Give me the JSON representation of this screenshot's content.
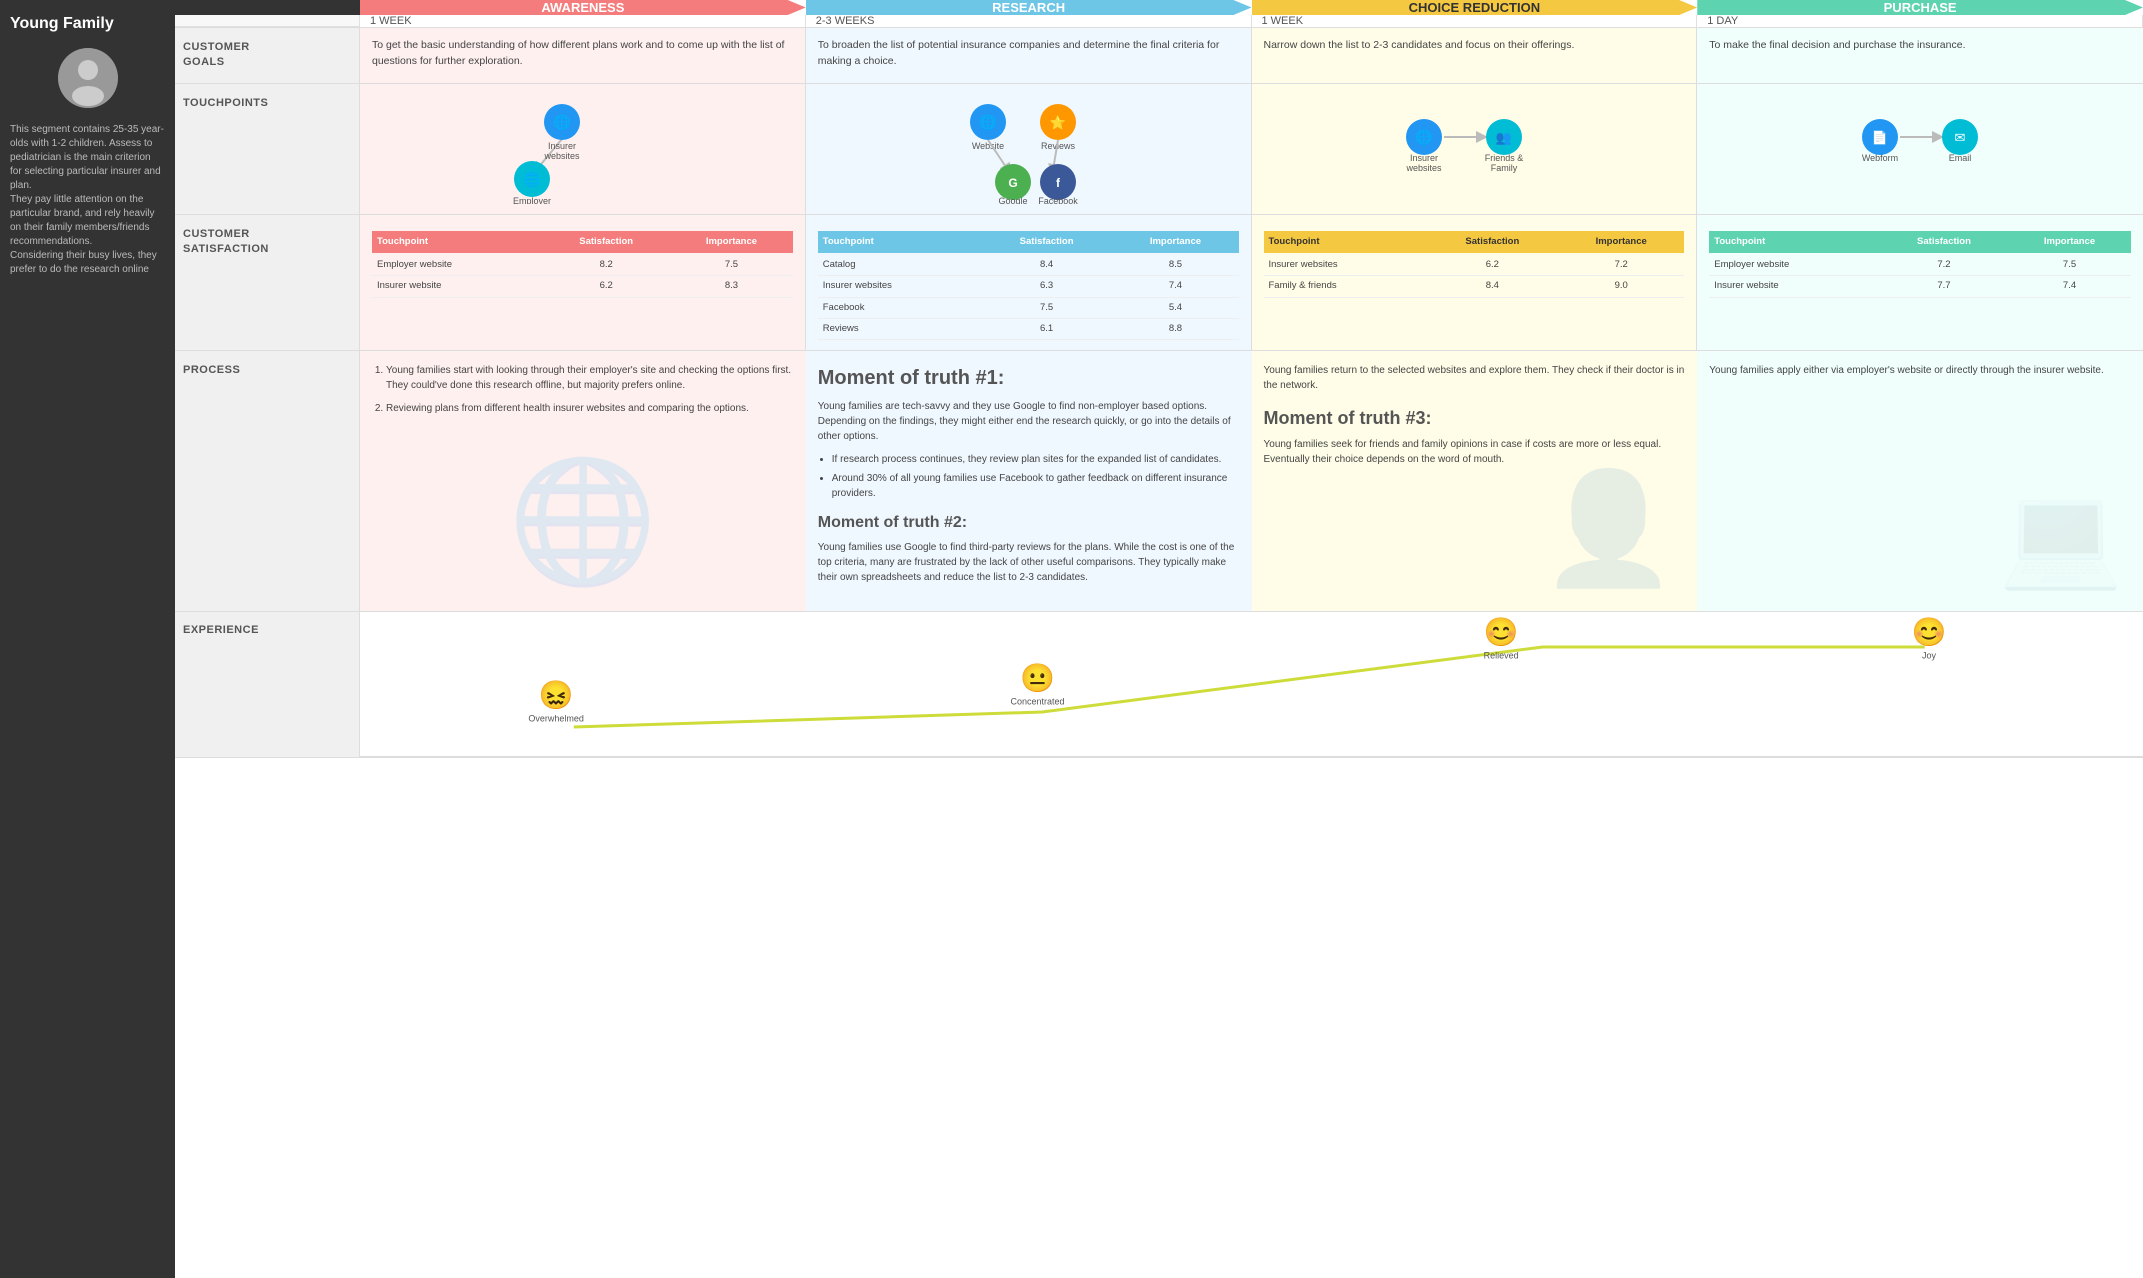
{
  "sidebar": {
    "title": "Young Family",
    "description": "This segment contains 25-35 year-olds with 1-2 children. Assess to pediatrician is the main criterion for selecting particular insurer and plan.\nThey pay little attention on the particular brand, and rely heavily on their family members/friends recommendations.\nConsidering their busy lives, they prefer to do the research online"
  },
  "phases": [
    {
      "id": "awareness",
      "label": "AWARENESS",
      "color": "#f47c7c",
      "time": "1 WEEK",
      "bg": "bg-pink"
    },
    {
      "id": "research",
      "label": "RESEARCH",
      "color": "#6ec6e6",
      "time": "2-3 WEEKS",
      "bg": "bg-blue"
    },
    {
      "id": "choice",
      "label": "CHOICE REDUCTION",
      "color": "#f5c842",
      "time": "1 WEEK",
      "bg": "bg-yellow"
    },
    {
      "id": "purchase",
      "label": "PURCHASE",
      "color": "#5dd3b0",
      "time": "1 DAY",
      "bg": "bg-teal"
    }
  ],
  "rows": {
    "customer_goals": {
      "label": "CUSTOMER GOALS",
      "cells": [
        "To get the basic understanding of how different plans work and to come up with the list of questions for further exploration.",
        "To broaden the list of potential insurance companies and determine the final criteria for making a choice.",
        "Narrow down the list to 2-3 candidates and focus on their offerings.",
        "To make the final decision and purchase the insurance."
      ]
    },
    "touchpoints": {
      "label": "TOUCHPOINTS",
      "awareness": {
        "items": [
          {
            "label": "Insurer websites",
            "icon": "🌐",
            "color": "blue"
          },
          {
            "label": "Employer Website",
            "icon": "🌐",
            "color": "cyan"
          }
        ]
      },
      "research": {
        "items": [
          {
            "label": "Website",
            "icon": "🌐",
            "color": "blue"
          },
          {
            "label": "Reviews",
            "icon": "⭐",
            "color": "orange"
          },
          {
            "label": "Google",
            "icon": "G",
            "color": "green"
          },
          {
            "label": "Facebook",
            "icon": "f",
            "color": "blue"
          }
        ]
      },
      "choice": {
        "items": [
          {
            "label": "Insurer websites",
            "icon": "🌐",
            "color": "blue"
          },
          {
            "label": "Friends & Family",
            "icon": "👥",
            "color": "cyan"
          }
        ]
      },
      "purchase": {
        "items": [
          {
            "label": "Webform",
            "icon": "📄",
            "color": "blue"
          },
          {
            "label": "Email",
            "icon": "✉",
            "color": "cyan"
          }
        ]
      }
    },
    "satisfaction": {
      "label": "CUSTOMER SATISFACTION",
      "tables": [
        {
          "phase_color": "#f47c7c",
          "headers": [
            "Touchpoint",
            "Satisfaction",
            "Importance"
          ],
          "rows": [
            [
              "Employer website",
              "8.2",
              "7.5"
            ],
            [
              "Insurer website",
              "6.2",
              "8.3"
            ]
          ]
        },
        {
          "phase_color": "#6ec6e6",
          "headers": [
            "Touchpoint",
            "Satisfaction",
            "Importance"
          ],
          "rows": [
            [
              "Catalog",
              "8.4",
              "8.5"
            ],
            [
              "Insurer websites",
              "6.3",
              "7.4"
            ],
            [
              "Facebook",
              "7.5",
              "5.4"
            ],
            [
              "Reviews",
              "6.1",
              "8.8"
            ]
          ]
        },
        {
          "phase_color": "#f5c842",
          "headers": [
            "Touchpoint",
            "Satisfaction",
            "Importance"
          ],
          "rows": [
            [
              "Insurer websites",
              "6.2",
              "7.2"
            ],
            [
              "Family & friends",
              "8.4",
              "9.0"
            ]
          ]
        },
        {
          "phase_color": "#5dd3b0",
          "headers": [
            "Touchpoint",
            "Satisfaction",
            "Importance"
          ],
          "rows": [
            [
              "Employer website",
              "7.2",
              "7.5"
            ],
            [
              "Insurer website",
              "7.7",
              "7.4"
            ]
          ]
        }
      ]
    },
    "process": {
      "label": "PROCESS",
      "cells": [
        {
          "type": "list",
          "items": [
            "Young families start with looking through their employer's site and checking the options first. They could've done this research offline, but majority prefers online.",
            "Reviewing plans from different health insurer websites and comparing the options."
          ]
        },
        {
          "type": "moments",
          "moment1_title": "Moment of truth #1:",
          "moment1_text": "Young families are tech-savvy and they use Google to find non-employer based options. Depending on the findings, they might either end the research quickly, or go into the details of other options.",
          "sub_items": [
            "If research process continues, they review plan sites for the expanded list of candidates.",
            "Around 30% of all young families use Facebook to gather feedback on different insurance providers."
          ],
          "moment2_title": "Moment of truth #2:",
          "moment2_text": "Young families use Google to find third-party reviews for the plans. While the cost is one of the top criteria, many are frustrated by the lack of other useful comparisons. They typically make their own spreadsheets and reduce the list to 2-3 candidates."
        },
        {
          "type": "moments3",
          "text": "Young families return to the selected websites and explore them. They check if their doctor is in the network.",
          "moment3_title": "Moment of truth #3:",
          "moment3_text": "Young families seek for friends and family opinions in case if costs are more or less equal. Eventually their choice depends on the word of mouth."
        },
        {
          "type": "text",
          "text": "Young families apply either via employer's website or directly through the insurer website."
        }
      ]
    },
    "experience": {
      "label": "EXPERIENCE",
      "emotions": [
        {
          "x": 12,
          "y": 75,
          "label": "Overwhelmed",
          "emoji": "😖",
          "color": "#e91e63"
        },
        {
          "x": 37,
          "y": 55,
          "label": "Concentrated",
          "emoji": "😐",
          "color": "#FF9800"
        },
        {
          "x": 62,
          "y": 20,
          "label": "Relieved",
          "emoji": "😊",
          "color": "#4CAF50"
        },
        {
          "x": 87,
          "y": 20,
          "label": "Joy",
          "emoji": "😊",
          "color": "#4CAF50"
        }
      ]
    }
  }
}
